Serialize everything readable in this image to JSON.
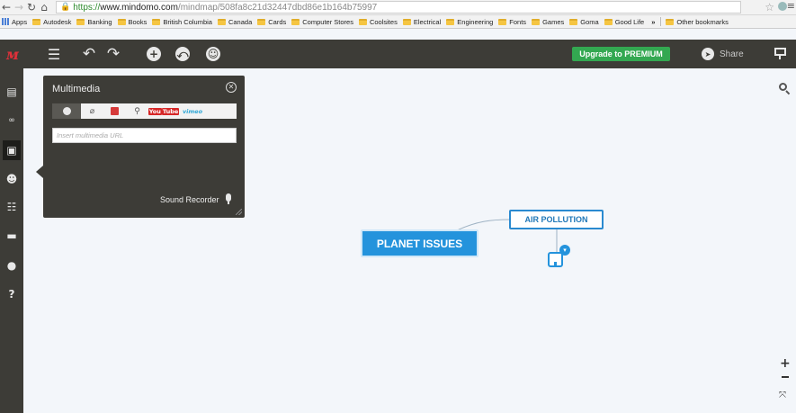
{
  "browser": {
    "url_scheme": "https://",
    "url_host": "www.mindomo.com",
    "url_path": "/mindmap/508fa8c21d32447dbd86e1b164b75997",
    "bookmarks": [
      "Apps",
      "Autodesk",
      "Banking",
      "Books",
      "British Columbia",
      "Canada",
      "Cards",
      "Computer Stores",
      "Coolsites",
      "Electrical",
      "Engineering",
      "Fonts",
      "Games",
      "Goma",
      "Good Life"
    ],
    "bookmarks_more": "»",
    "other_bookmarks": "Other bookmarks"
  },
  "toolbar": {
    "upgrade_label": "Upgrade to PREMIUM",
    "share_label": "Share",
    "icons": [
      "hamburger-menu-icon",
      "undo-icon",
      "redo-icon",
      "add-topic-icon",
      "relationship-icon",
      "smiley-icon",
      "share-icon",
      "presentation-icon"
    ]
  },
  "sidebar": {
    "items": [
      "notes-icon",
      "link-icon",
      "image-icon",
      "emoticon-icon",
      "task-icon",
      "comments-icon",
      "ideas-icon",
      "help-icon"
    ],
    "active": "image-icon"
  },
  "multimedia_panel": {
    "title": "Multimedia",
    "tabs": [
      "web",
      "attachment",
      "mindomo",
      "search",
      "YouTube",
      "vimeo"
    ],
    "youtube_you": "You",
    "youtube_tube": "Tube",
    "vimeo_label": "vimeo",
    "url_placeholder": "Insert multimedia URL",
    "sound_recorder_label": "Sound Recorder"
  },
  "mindmap": {
    "central_topic": "PLANET ISSUES",
    "subtopic": "AIR POLLUTION"
  },
  "zoom": {
    "zoom_in": "+",
    "fit": "⤧"
  },
  "colors": {
    "toolbar_bg": "#3d3c37",
    "accent_blue": "#2493dc",
    "upgrade_green": "#33a851",
    "canvas_bg": "#f3f6fa"
  }
}
